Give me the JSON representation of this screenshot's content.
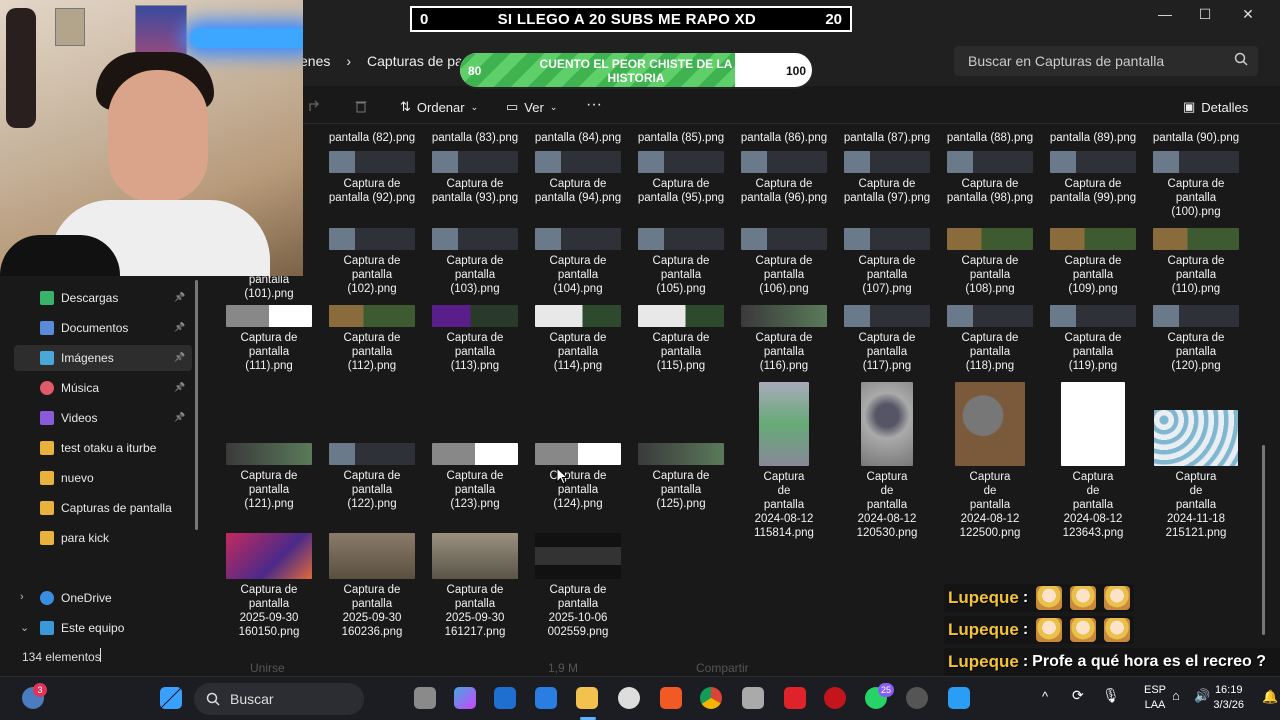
{
  "overlay": {
    "sub_counter": {
      "left": "0",
      "title": "SI LLEGO A 20 SUBS ME RAPO XD",
      "right": "20"
    },
    "goal": {
      "min": "80",
      "max": "100",
      "text": "CUENTO EL PEOR CHISTE DE LA HISTORIA",
      "progress_fraction": 0.78
    }
  },
  "window": {
    "controls": {
      "minimize": "—",
      "maximize": "☐",
      "close": "✕"
    },
    "breadcrumb": [
      "enes",
      "›",
      "Capturas de pant"
    ],
    "search_placeholder": "Buscar en Capturas de pantalla",
    "toolbar": {
      "sort": "Ordenar",
      "view": "Ver",
      "more": "···",
      "details": "Detalles"
    }
  },
  "sidebar": {
    "items": [
      {
        "label": "Descargas",
        "icon": "download-icon",
        "pinned": true
      },
      {
        "label": "Documentos",
        "icon": "document-icon",
        "pinned": true
      },
      {
        "label": "Imágenes",
        "icon": "image-icon",
        "pinned": true,
        "selected": true
      },
      {
        "label": "Música",
        "icon": "music-icon",
        "pinned": true
      },
      {
        "label": "Videos",
        "icon": "video-icon",
        "pinned": true
      },
      {
        "label": "test otaku a iturbe",
        "icon": "folder-icon"
      },
      {
        "label": "nuevo",
        "icon": "folder-icon"
      },
      {
        "label": "Capturas de pantalla",
        "icon": "folder-icon"
      },
      {
        "label": "para kick",
        "icon": "folder-icon"
      },
      {
        "label": "OneDrive",
        "icon": "cloud-icon",
        "expand": "›"
      },
      {
        "label": "Este equipo",
        "icon": "pc-icon",
        "expand": "⌄"
      }
    ]
  },
  "files": {
    "row0": [
      "pantalla (82).png",
      "pantalla (83).png",
      "pantalla (84).png",
      "pantalla (85).png",
      "pantalla (86).png",
      "pantalla (87).png",
      "pantalla (88).png",
      "pantalla (89).png",
      "pantalla (90).png"
    ],
    "row1": [
      [
        "Captura de",
        "pantalla (92).png"
      ],
      [
        "Captura de",
        "pantalla (93).png"
      ],
      [
        "Captura de",
        "pantalla (94).png"
      ],
      [
        "Captura de",
        "pantalla (95).png"
      ],
      [
        "Captura de",
        "pantalla (96).png"
      ],
      [
        "Captura de",
        "pantalla (97).png"
      ],
      [
        "Captura de",
        "pantalla (98).png"
      ],
      [
        "Captura de",
        "pantalla (99).png"
      ],
      [
        "Captura de",
        "pantalla",
        "(100).png"
      ]
    ],
    "row2": [
      [
        "pantalla",
        "(101).png"
      ],
      [
        "Captura de",
        "pantalla",
        "(102).png"
      ],
      [
        "Captura de",
        "pantalla",
        "(103).png"
      ],
      [
        "Captura de",
        "pantalla",
        "(104).png"
      ],
      [
        "Captura de",
        "pantalla",
        "(105).png"
      ],
      [
        "Captura de",
        "pantalla",
        "(106).png"
      ],
      [
        "Captura de",
        "pantalla",
        "(107).png"
      ],
      [
        "Captura de",
        "pantalla",
        "(108).png"
      ],
      [
        "Captura de",
        "pantalla",
        "(109).png"
      ],
      [
        "Captura de",
        "pantalla",
        "(110).png"
      ]
    ],
    "row3": [
      [
        "Captura de",
        "pantalla",
        "(111).png"
      ],
      [
        "Captura de",
        "pantalla",
        "(112).png"
      ],
      [
        "Captura de",
        "pantalla",
        "(113).png"
      ],
      [
        "Captura de",
        "pantalla",
        "(114).png"
      ],
      [
        "Captura de",
        "pantalla",
        "(115).png"
      ],
      [
        "Captura de",
        "pantalla",
        "(116).png"
      ],
      [
        "Captura de",
        "pantalla",
        "(117).png"
      ],
      [
        "Captura de",
        "pantalla",
        "(118).png"
      ],
      [
        "Captura de",
        "pantalla",
        "(119).png"
      ],
      [
        "Captura de",
        "pantalla",
        "(120).png"
      ]
    ],
    "row4": [
      [
        "Captura de",
        "pantalla",
        "(121).png"
      ],
      [
        "Captura de",
        "pantalla",
        "(122).png"
      ],
      [
        "Captura de",
        "pantalla",
        "(123).png"
      ],
      [
        "Captura de",
        "pantalla",
        "(124).png"
      ],
      [
        "Captura de",
        "pantalla",
        "(125).png"
      ],
      [
        "Captura",
        "de",
        "pantalla",
        "2024-08-12",
        "115814.png"
      ],
      [
        "Captura",
        "de",
        "pantalla",
        "2024-08-12",
        "120530.png"
      ],
      [
        "Captura",
        "de",
        "pantalla",
        "2024-08-12",
        "122500.png"
      ],
      [
        "Captura",
        "de",
        "pantalla",
        "2024-08-12",
        "123643.png"
      ],
      [
        "Captura",
        "de",
        "pantalla",
        "2024-11-18",
        "215121.png"
      ]
    ],
    "row5": [
      [
        "Captura de",
        "pantalla",
        "2025-09-30",
        "160150.png"
      ],
      [
        "Captura de",
        "pantalla",
        "2025-09-30",
        "160236.png"
      ],
      [
        "Captura de",
        "pantalla",
        "2025-09-30",
        "161217.png"
      ],
      [
        "Captura de",
        "pantalla",
        "2025-10-06",
        "002559.png"
      ]
    ]
  },
  "status": {
    "count": "134 elementos",
    "ghost": [
      "Unirse",
      "1,9 M",
      "Compartir"
    ]
  },
  "chat": [
    {
      "user": "Lupeque",
      "sep": ":",
      "emotes": 3
    },
    {
      "user": "Lupeque",
      "sep": ":",
      "emotes": 3
    },
    {
      "user": "Lupeque",
      "sep": ":",
      "message": "Profe a qué hora es el recreo ?"
    }
  ],
  "taskbar": {
    "search": "Buscar",
    "notif_badge": "3",
    "whatsapp_badge": "25",
    "lang": [
      "ESP",
      "LAA"
    ],
    "time": "16:19",
    "date": "3/3/26"
  },
  "colors": {
    "chat_name": "#f5c23a",
    "accent": "#3da6ff",
    "progress": "#3fb34f"
  }
}
